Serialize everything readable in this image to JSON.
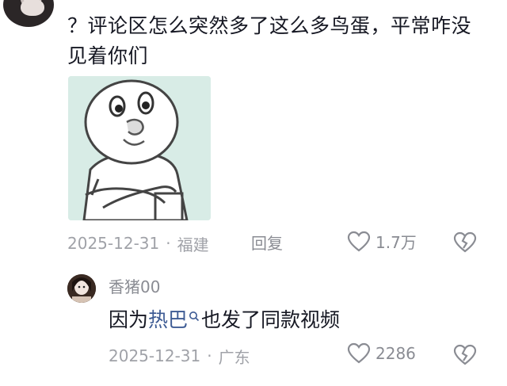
{
  "comment": {
    "text": "？评论区怎么突然多了这么多鸟蛋，平常咋没见着你们",
    "date": "2025-12-31",
    "separator": "·",
    "location": "福建",
    "reply_label": "回复",
    "like_count": "1.7万"
  },
  "reply": {
    "username": "香猪00",
    "text_before": "因为",
    "link_text": "热巴",
    "text_after": "也发了同款视频",
    "date": "2025-12-31",
    "separator": "·",
    "location": "广东",
    "like_count": "2286"
  },
  "colors": {
    "link": "#3d5b94",
    "meta": "#a0a2a8",
    "text": "#161823"
  }
}
